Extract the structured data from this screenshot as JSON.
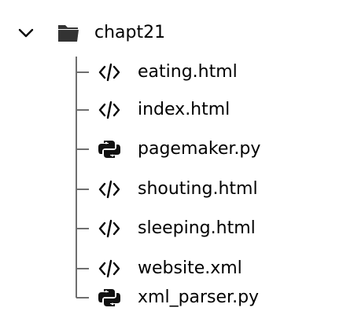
{
  "tree": {
    "root": {
      "label": "chapt21",
      "icon": "folder-icon",
      "expanded": true
    },
    "children": [
      {
        "label": "eating.html",
        "icon": "code-icon"
      },
      {
        "label": "index.html",
        "icon": "code-icon"
      },
      {
        "label": "pagemaker.py",
        "icon": "python-icon"
      },
      {
        "label": "shouting.html",
        "icon": "code-icon"
      },
      {
        "label": "sleeping.html",
        "icon": "code-icon"
      },
      {
        "label": "website.xml",
        "icon": "code-icon"
      },
      {
        "label": "xml_parser.py",
        "icon": "python-icon"
      }
    ]
  }
}
